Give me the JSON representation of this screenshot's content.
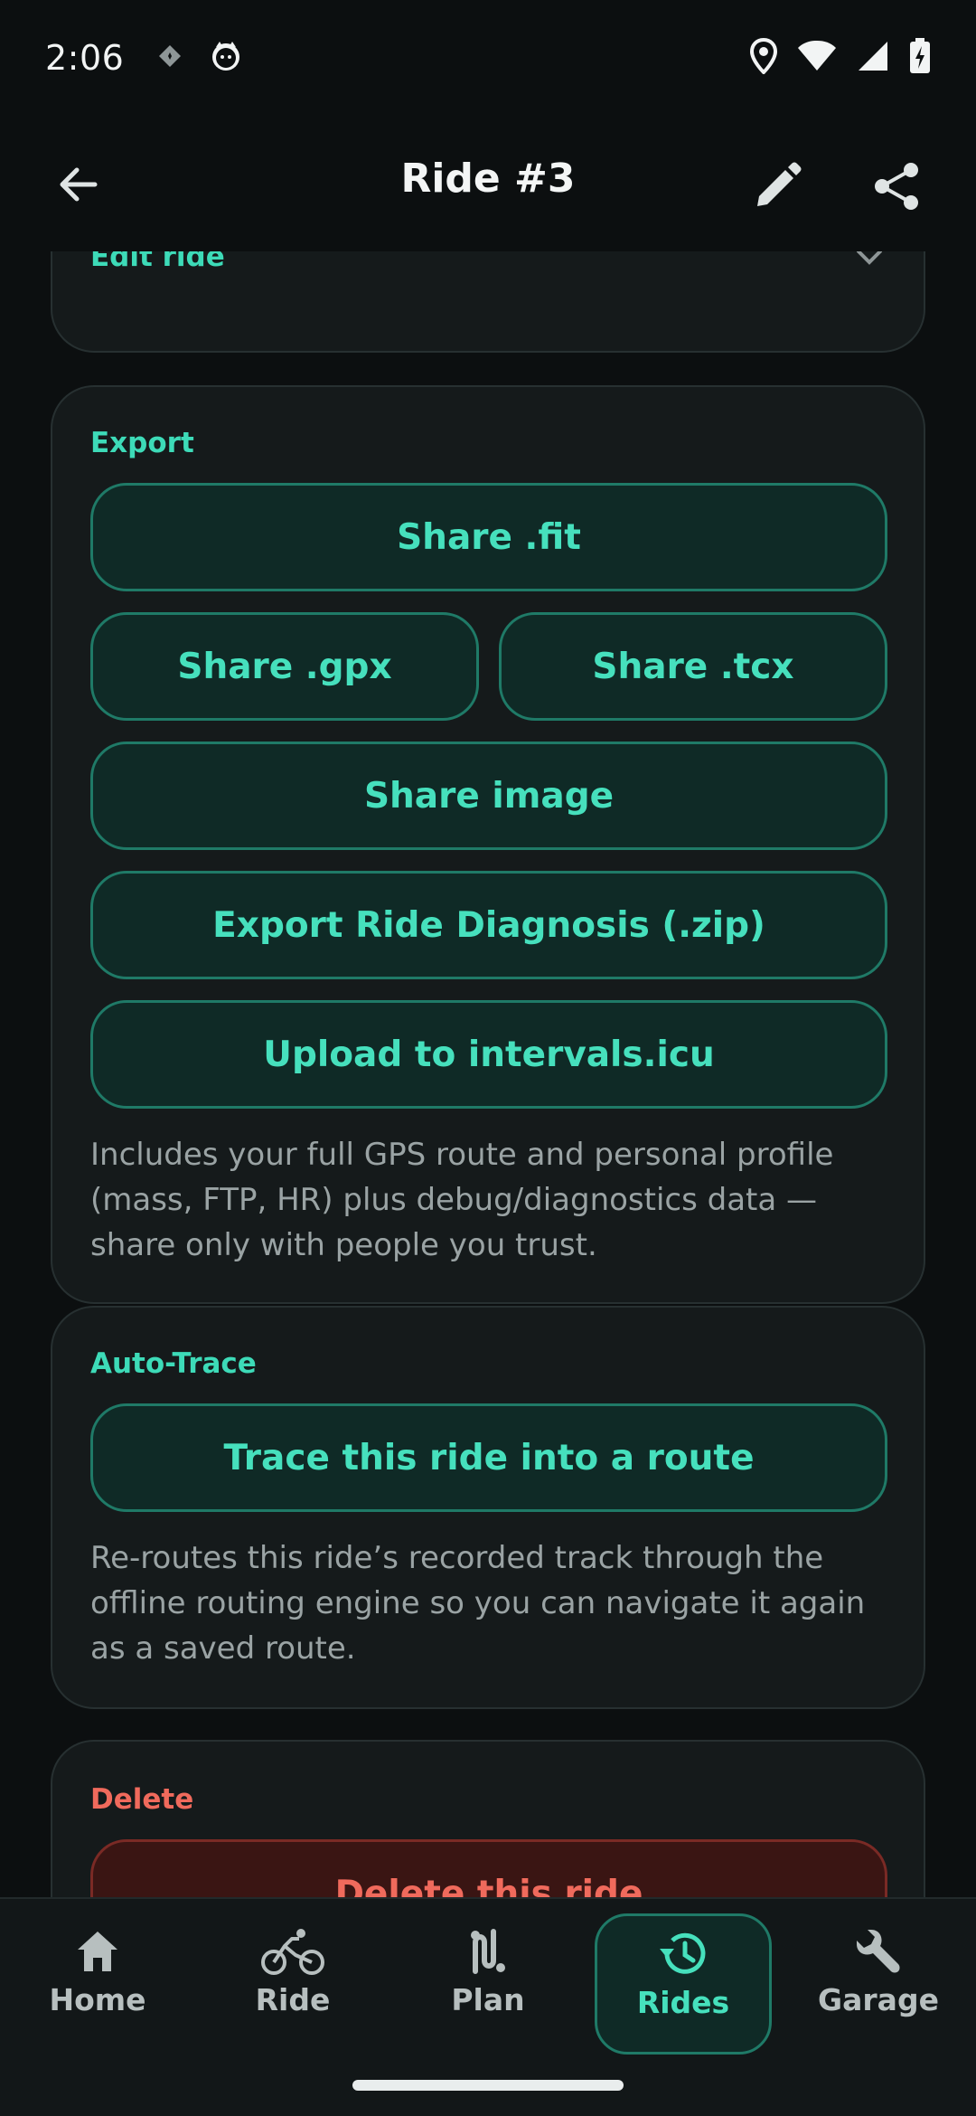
{
  "status_bar": {
    "time": "2:06"
  },
  "app_bar": {
    "title": "Ride #3"
  },
  "edit_ride_card": {
    "title": "Edit ride"
  },
  "export_card": {
    "title": "Export",
    "share_fit": "Share .fit",
    "share_gpx": "Share .gpx",
    "share_tcx": "Share .tcx",
    "share_image": "Share image",
    "export_diagnosis": "Export Ride Diagnosis (.zip)",
    "upload_intervals": "Upload to intervals.icu",
    "note": "Includes your full GPS route and personal profile (mass, FTP, HR) plus debug/diagnostics data — share only with people you trust."
  },
  "auto_trace_card": {
    "title": "Auto-Trace",
    "trace_button": "Trace this ride into a route",
    "note": "Re-routes this ride’s recorded track through the offline routing engine so you can navigate it again as a saved route."
  },
  "delete_card": {
    "title": "Delete",
    "delete_button": "Delete this ride"
  },
  "bottom_nav": {
    "items": [
      {
        "label": "Home",
        "icon": "home-icon"
      },
      {
        "label": "Ride",
        "icon": "bicycle-icon"
      },
      {
        "label": "Plan",
        "icon": "route-icon"
      },
      {
        "label": "Rides",
        "icon": "history-icon",
        "active": true
      },
      {
        "label": "Garage",
        "icon": "wrench-icon"
      }
    ]
  },
  "colors": {
    "accent": "#46e0bd",
    "danger": "#f06a5c",
    "background": "#0c0f10",
    "card": "#151a1b"
  }
}
